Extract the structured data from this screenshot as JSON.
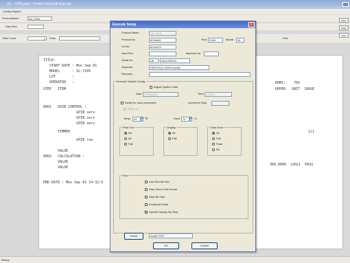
{
  "app": {
    "title": "SC - 7205.pam - Protect Test Edit Execute",
    "menu": "Config   Help(H)",
    "toolbar": {
      "product_name_label": "ProductName",
      "product_name_value": "SC-7205",
      "hard_rev_label": "Hard Rev",
      "total_count_label": "Total Count",
      "total_count_value": "1",
      "pass_label": "Pass",
      "fail_label": "FAIL",
      "right_buttons": [
        "Run",
        "Stop",
        "Exit"
      ]
    },
    "status": "Ready"
  },
  "report": {
    "lines": [
      "TITLE:",
      "   START DATE : Mon Sep 01",
      "   MODEL      : SC-7205",
      "   LOT        :",
      "   OPERATOR   :",
      "STEP   ITEM",
      "0001   GPIB CONTROL :",
      "                GPIB serv",
      "                GPIB serv",
      "                GPIB serv",
      "       TIMMER",
      "                GPIB roe",
      "       VALUE",
      "0002   CALCULATION :",
      "       VALUE",
      "       VALUE",
      "END DATE : Mon Sep 01 14:32:5"
    ],
    "humi": "HUMI:    70%",
    "header_right": "UPPER   UNIT  JUDGE",
    "timer_unit": "[s]",
    "result_row": "300.0000  [kHz]  PASS"
  },
  "dialog": {
    "title": "Execute Setup",
    "close": "×",
    "fields": {
      "product_name_label": "Product Name",
      "product_name_value": "SC-7205",
      "product_no_label": "Product No",
      "product_no_value": "8234600",
      "year_label": "Year",
      "year_value": "2008",
      "month_label": "Month",
      "month_value": "06",
      "lot_no_label": "Lot No",
      "lot_no_value": "8234678",
      "hard_rev_label": "Hard Rev",
      "machine_no_label": "Machine No",
      "serial_no_label": "Serial No",
      "serial_prefix": "AB",
      "serial_value": "0811233044",
      "inspector_label": "Inspector",
      "inspector_value": "KEDOX/Q-GKEN-Dudial",
      "remarks_label": "Remarks"
    },
    "config": {
      "title": "Execute Default Config",
      "adjust_system_date": "Adjust System Date",
      "date_label": "Date",
      "date_value": "2008/09/01",
      "time_label": "Time",
      "time_value": "14:32:5",
      "serial_auto_increment": "Serial No. Auto Increment",
      "increment_step_label": "Increment Step",
      "print_lot": "Print Lot",
      "temp_label": "Temp",
      "temp_value": "20",
      "temp_unit": "℃",
      "humi_label": "Humi",
      "humi_value": "70",
      "humi_unit": "%"
    },
    "print_out": {
      "title": "Print Out",
      "options": [
        "No",
        "All",
        "Fail"
      ],
      "selected": 0
    },
    "display": {
      "title": "Display",
      "options": [
        "All",
        "Fail"
      ],
      "selected": 0
    },
    "data_save": {
      "title": "Data Save",
      "options": [
        "All",
        "Fail",
        "Pass",
        "No"
      ],
      "selected": 0
    },
    "run": {
      "title": "Run",
      "options": [
        {
          "label": "Use Remote Box",
          "checked": false
        },
        {
          "label": "Stop When Fail Occurs",
          "checked": false
        },
        {
          "label": "Step By Step",
          "checked": false
        },
        {
          "label": "Graphical Mode",
          "checked": false
        },
        {
          "label": "Update Display By Step",
          "checked": true
        }
      ]
    },
    "printer_button": "Printer",
    "printer_name": "Adobe PDF",
    "ok": "OK",
    "cancel": "Cancel"
  }
}
